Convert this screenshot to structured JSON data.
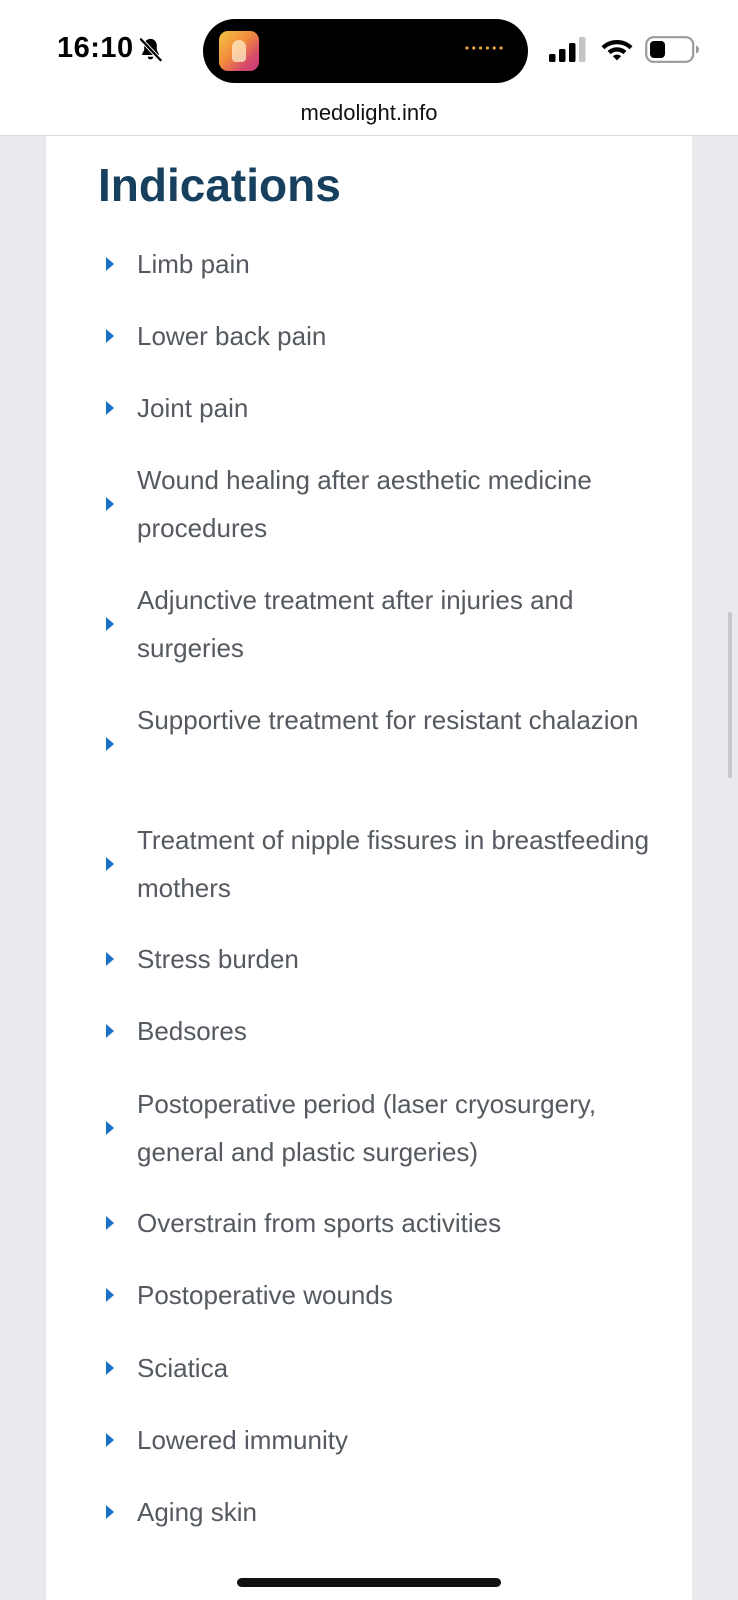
{
  "status_bar": {
    "time": "16:10"
  },
  "browser": {
    "url": "medolight.info"
  },
  "section": {
    "title": "Indications"
  },
  "indications": [
    "Limb pain",
    "Lower back pain",
    "Joint pain",
    "Wound healing after aesthetic medicine procedures",
    "Adjunctive treatment after injuries and surgeries",
    "Supportive treatment for resistant chalazion",
    "Treatment of nipple fissures in breastfeeding mothers",
    "Stress burden",
    "Bedsores",
    "Postoperative period (laser cryosurgery, general and plastic surgeries)",
    "Overstrain from sports activities",
    "Postoperative wounds",
    "Sciatica",
    "Lowered immunity",
    "Aging skin"
  ],
  "colors": {
    "title": "#17405f",
    "bullet": "#1a72c4",
    "item_text": "#555a60",
    "page_background": "#ebe9ed"
  },
  "icons": {
    "silent_mode": "bell-slash-icon",
    "signal": "cellular-signal-icon",
    "wifi": "wifi-icon",
    "battery": "battery-icon",
    "bullet": "triangle-right-icon"
  }
}
